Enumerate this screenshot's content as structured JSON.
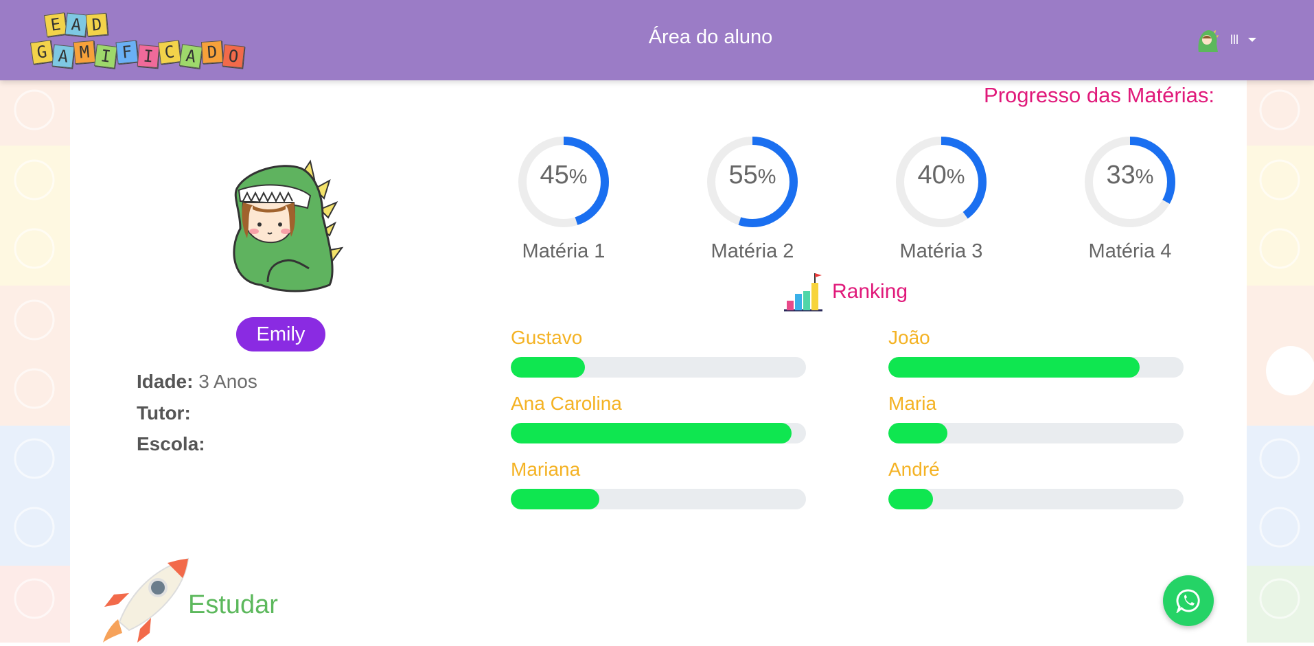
{
  "header": {
    "title": "Área do aluno",
    "logo_row1": [
      "E",
      "A",
      "D"
    ],
    "logo_row2": [
      "G",
      "A",
      "M",
      "I",
      "F",
      "I",
      "C",
      "A",
      "D",
      "O"
    ],
    "user_label": "lll"
  },
  "progress": {
    "title": "Progresso das Matérias:",
    "items": [
      {
        "label": "Matéria 1",
        "value": "45",
        "unit": "%",
        "fraction": 0.45
      },
      {
        "label": "Matéria 2",
        "value": "55",
        "unit": "%",
        "fraction": 0.55
      },
      {
        "label": "Matéria 3",
        "value": "40",
        "unit": "%",
        "fraction": 0.4
      },
      {
        "label": "Matéria 4",
        "value": "33",
        "unit": "%",
        "fraction": 0.33
      }
    ]
  },
  "student": {
    "name": "Emily",
    "age_label": "Idade:",
    "age_value": "3 Anos",
    "tutor_label": "Tutor:",
    "school_label": "Escola:"
  },
  "ranking": {
    "title": "Ranking",
    "left": [
      {
        "name": "Gustavo",
        "fraction": 0.25
      },
      {
        "name": "Ana Carolina",
        "fraction": 0.95
      },
      {
        "name": "Mariana",
        "fraction": 0.3
      }
    ],
    "right": [
      {
        "name": "João",
        "fraction": 0.85
      },
      {
        "name": "Maria",
        "fraction": 0.2
      },
      {
        "name": "André",
        "fraction": 0.15
      }
    ]
  },
  "study": {
    "label": "Estudar"
  },
  "colors": {
    "header": "#9b7cc6",
    "accent_pink": "#e0197a",
    "badge_purple": "#8a2be2",
    "donut_blue": "#1a6ff0",
    "bar_green": "#0fe650",
    "rank_name": "#f4b223",
    "study_green": "#5cb85c",
    "whatsapp": "#25d366"
  },
  "icons": [
    "dino-avatar-icon",
    "ranking-chart-icon",
    "rocket-icon",
    "whatsapp-icon",
    "chevron-down-icon"
  ]
}
